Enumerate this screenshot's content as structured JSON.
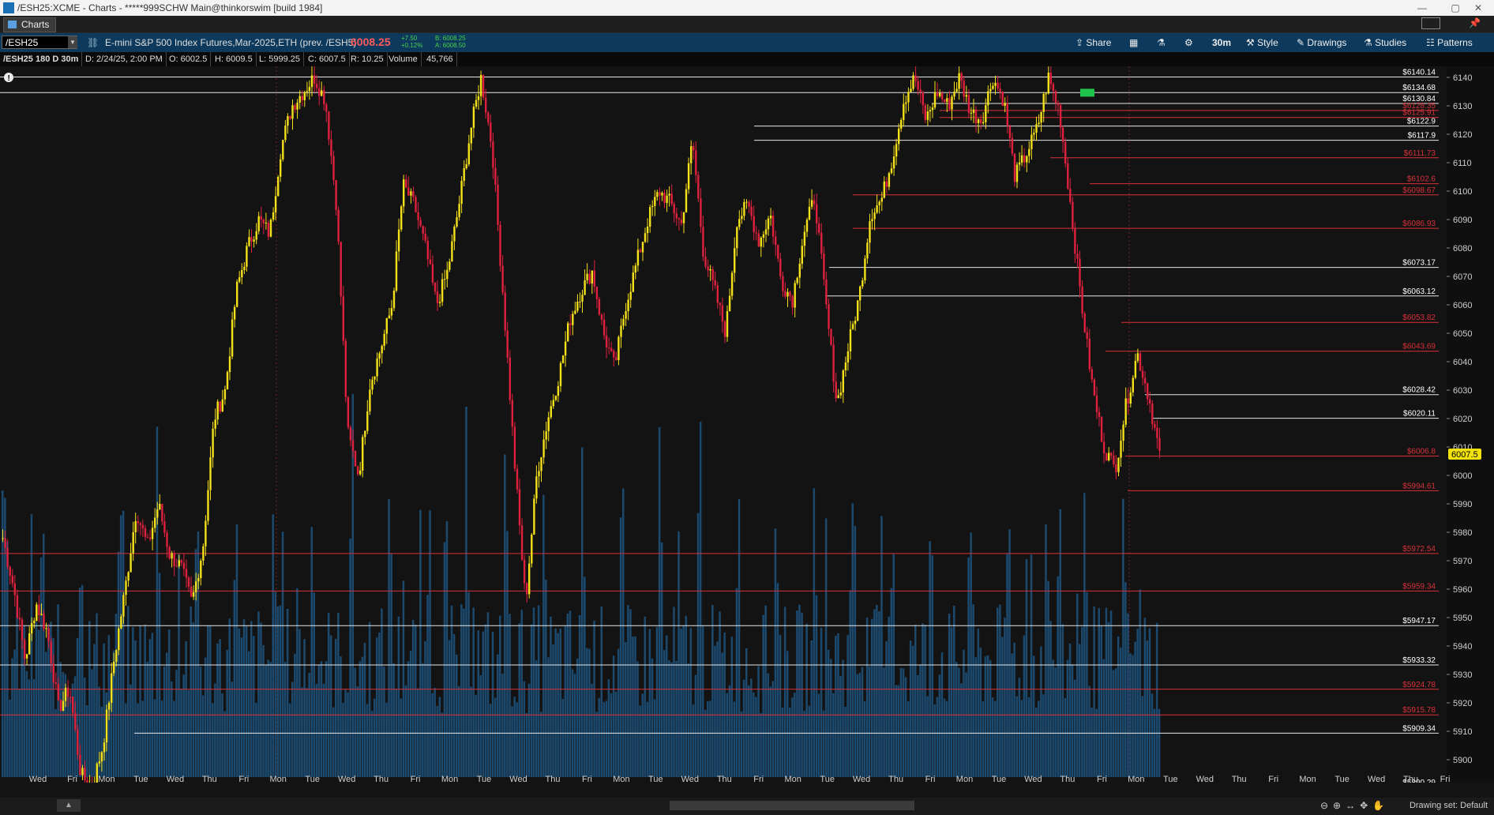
{
  "window": {
    "title": "/ESH25:XCME - Charts - *****999SCHW Main@thinkorswim [build 1984]",
    "controls": [
      "—",
      "▢",
      "✕"
    ]
  },
  "tabs": {
    "charts_label": "Charts"
  },
  "toolbar": {
    "symbol": "/ESH25",
    "description": "E-mini S&P 500 Index Futures,Mar-2025,ETH (prev. /ESH5)",
    "last_price": "6008.25",
    "net_change": "+7.50",
    "pct_change": "+0.12%",
    "bid": "B: 6008.25",
    "ask": "A: 6008.50",
    "share": "Share",
    "timeframe": "30m",
    "style": "Style",
    "drawings": "Drawings",
    "studies": "Studies",
    "patterns": "Patterns"
  },
  "infobar": {
    "chart_id": "/ESH25 180 D 30m",
    "date": "D: 2/24/25, 2:00 PM",
    "open": "O: 6002.5",
    "high": "H: 6009.5",
    "low": "L: 5999.25",
    "close": "C: 6007.5",
    "range": "R: 10.25",
    "volume_label": "Volume",
    "volume_value": "45,766"
  },
  "colors": {
    "up_candle": "#f5e11a",
    "down_candle": "#e0213e",
    "volume": "#1c4a6e",
    "white_level": "#e6e6e6",
    "red_level": "#d9313a",
    "price_badge": "#f2e20c"
  },
  "chart_data": {
    "type": "candlestick",
    "y_axis": {
      "min": 5890,
      "max": 6140,
      "ticks": [
        "6140",
        "6130",
        "6120",
        "6110",
        "6100",
        "6090",
        "6080",
        "6070",
        "6060",
        "6050",
        "6040",
        "6030",
        "6020",
        "6010",
        "6000",
        "5990",
        "5980",
        "5970",
        "5960",
        "5950",
        "5940",
        "5930",
        "5920",
        "5910",
        "5900"
      ]
    },
    "x_axis_labels": [
      "Wed",
      "Fri",
      "Mon",
      "Tue",
      "Wed",
      "Thu",
      "Fri",
      "Mon",
      "Tue",
      "Wed",
      "Thu",
      "Fri",
      "Mon",
      "Tue",
      "Wed",
      "Thu",
      "Fri",
      "Mon",
      "Tue",
      "Wed",
      "Thu",
      "Fri",
      "Mon",
      "Tue",
      "Wed",
      "Thu",
      "Fri",
      "Mon",
      "Tue",
      "Wed",
      "Thu",
      "Fri",
      "Mon",
      "Tue",
      "Wed",
      "Thu",
      "Fri",
      "Mon",
      "Tue",
      "Wed",
      "Thu",
      "Fri"
    ],
    "current_price": "6007.5",
    "price_levels": [
      {
        "label": "$6140.14",
        "value": 6140.14,
        "color": "white"
      },
      {
        "label": "$6134.68",
        "value": 6134.68,
        "color": "white"
      },
      {
        "label": "$6130.84",
        "value": 6130.84,
        "color": "white"
      },
      {
        "label": "$6128.35",
        "value": 6128.35,
        "color": "red"
      },
      {
        "label": "$6125.91",
        "value": 6125.91,
        "color": "red"
      },
      {
        "label": "$6122.9",
        "value": 6122.9,
        "color": "white"
      },
      {
        "label": "$6117.9",
        "value": 6117.9,
        "color": "white"
      },
      {
        "label": "$6111.73",
        "value": 6111.73,
        "color": "red"
      },
      {
        "label": "$6102.6",
        "value": 6102.6,
        "color": "red"
      },
      {
        "label": "$6098.67",
        "value": 6098.67,
        "color": "red"
      },
      {
        "label": "$6086.93",
        "value": 6086.93,
        "color": "red"
      },
      {
        "label": "$6073.17",
        "value": 6073.17,
        "color": "white"
      },
      {
        "label": "$6063.12",
        "value": 6063.12,
        "color": "white"
      },
      {
        "label": "$6053.82",
        "value": 6053.82,
        "color": "red"
      },
      {
        "label": "$6043.69",
        "value": 6043.69,
        "color": "red"
      },
      {
        "label": "$6028.42",
        "value": 6028.42,
        "color": "white"
      },
      {
        "label": "$6020.11",
        "value": 6020.11,
        "color": "white"
      },
      {
        "label": "$6006.8",
        "value": 6006.8,
        "color": "red"
      },
      {
        "label": "$5994.61",
        "value": 5994.61,
        "color": "red"
      },
      {
        "label": "$5972.54",
        "value": 5972.54,
        "color": "red"
      },
      {
        "label": "$5959.34",
        "value": 5959.34,
        "color": "red"
      },
      {
        "label": "$5947.17",
        "value": 5947.17,
        "color": "white"
      },
      {
        "label": "$5933.32",
        "value": 5933.32,
        "color": "white"
      },
      {
        "label": "$5924.78",
        "value": 5924.78,
        "color": "red"
      },
      {
        "label": "$5915.78",
        "value": 5915.78,
        "color": "red"
      },
      {
        "label": "$5909.34",
        "value": 5909.34,
        "color": "white"
      },
      {
        "label": "$5890.29",
        "value": 5890.29,
        "color": "white"
      }
    ],
    "price_path_approx": [
      5978,
      5960,
      5935,
      5955,
      5945,
      5918,
      5925,
      5895,
      5890,
      5905,
      5935,
      5960,
      5988,
      5975,
      5990,
      5972,
      5968,
      5955,
      5975,
      6020,
      6030,
      6065,
      6080,
      6090,
      6085,
      6115,
      6130,
      6135,
      6140,
      6132,
      6095,
      6015,
      6000,
      6032,
      6045,
      6060,
      6102,
      6095,
      6080,
      6060,
      6072,
      6095,
      6120,
      6140,
      6115,
      6062,
      6005,
      5955,
      6000,
      6020,
      6035,
      6055,
      6065,
      6072,
      6050,
      6038,
      6060,
      6075,
      6090,
      6100,
      6096,
      6088,
      6118,
      6078,
      6065,
      6050,
      6090,
      6095,
      6082,
      6092,
      6068,
      6062,
      6085,
      6098,
      6060,
      6025,
      6045,
      6063,
      6092,
      6097,
      6112,
      6132,
      6140,
      6125,
      6135,
      6130,
      6140,
      6128,
      6125,
      6140,
      6132,
      6105,
      6113,
      6122,
      6140,
      6128,
      6095,
      6060,
      6030,
      6010,
      6002,
      6025,
      6043,
      6028,
      6007.5
    ]
  },
  "bottombar": {
    "drawing_set": "Drawing set: Default"
  }
}
